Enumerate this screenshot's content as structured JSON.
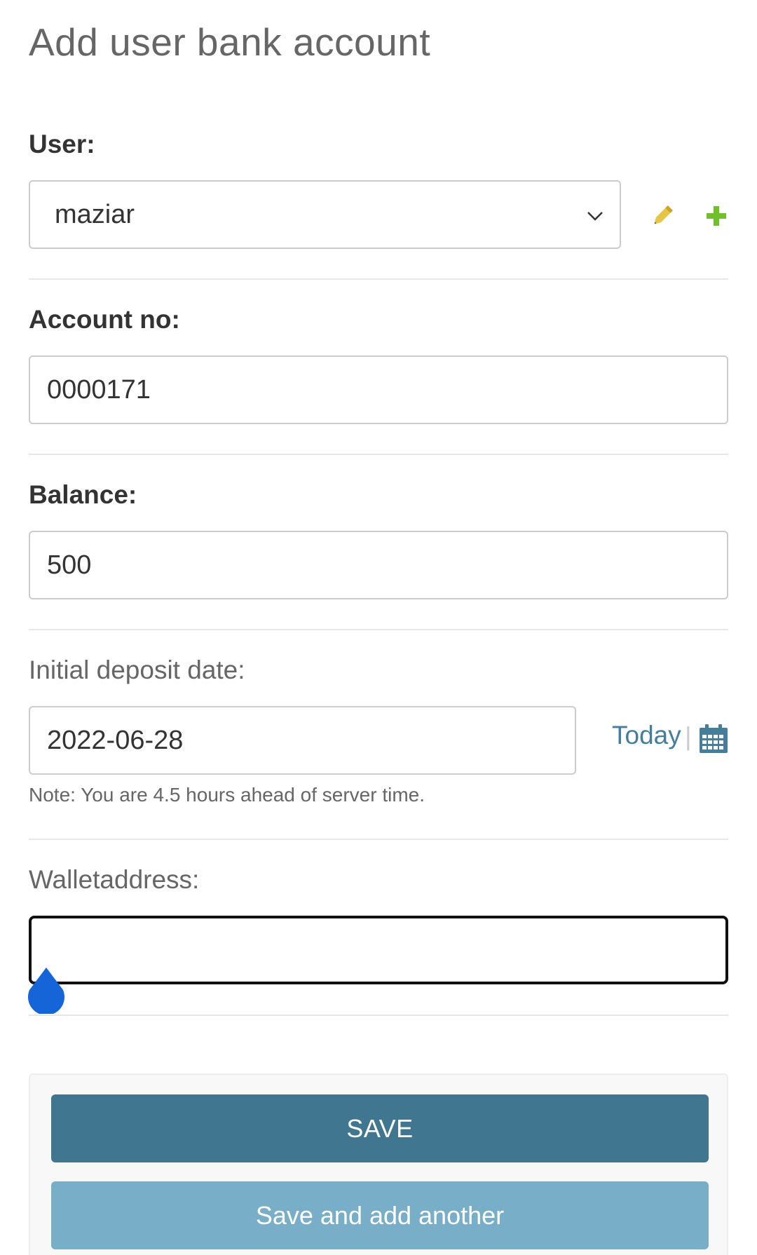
{
  "page": {
    "title": "Add user bank account"
  },
  "fields": {
    "user": {
      "label": "User:",
      "value": "maziar"
    },
    "account_no": {
      "label": "Account no:",
      "value": "0000171"
    },
    "balance": {
      "label": "Balance:",
      "value": "500"
    },
    "initial_deposit_date": {
      "label": "Initial deposit date:",
      "value": "2022-06-28",
      "today_link": "Today",
      "separator": "|",
      "note": "Note: You are 4.5 hours ahead of server time."
    },
    "walletaddress": {
      "label": "Walletaddress:",
      "value": ""
    }
  },
  "actions": {
    "save_label": "SAVE",
    "save_add_label": "Save and add another"
  },
  "icons": {
    "edit": "pencil-icon",
    "add": "plus-icon",
    "calendar": "calendar-icon",
    "select": "chevron-down-icon"
  },
  "colors": {
    "primary_button": "#417690",
    "secondary_button": "#79aec8",
    "link": "#447e9b",
    "edit_icon": "#e6c544",
    "add_icon": "#70bf2b",
    "caret_handle": "#1565d8"
  }
}
